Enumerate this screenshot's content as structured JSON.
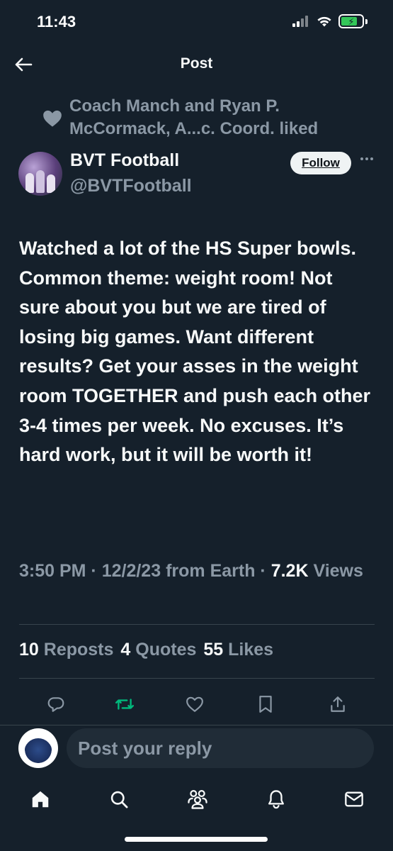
{
  "status_bar": {
    "time": "11:43"
  },
  "header": {
    "title": "Post"
  },
  "social_context": {
    "text": "Coach Manch and Ryan P. McCormack, A...c. Coord. liked"
  },
  "author": {
    "name": "BVT Football",
    "handle": "@BVTFootball",
    "follow_label": "Follow"
  },
  "post": {
    "text": "Watched a lot of the HS Super bowls. Common theme: weight room! Not sure about you but we are tired of losing big games. Want different results? Get your asses in the weight room TOGETHER and push each other 3-4 times per week. No excuses. It’s hard work, but it will be worth it!",
    "time": "3:50 PM",
    "date": "12/2/23",
    "source": "from Earth",
    "views_count": "7.2K",
    "views_label": "Views"
  },
  "stats": {
    "reposts_count": "10",
    "reposts_label": "Reposts",
    "quotes_count": "4",
    "quotes_label": "Quotes",
    "likes_count": "55",
    "likes_label": "Likes"
  },
  "actions": {
    "icons": [
      "reply-icon",
      "repost-icon",
      "like-icon",
      "bookmark-icon",
      "share-icon"
    ],
    "repost_color": "#00ba7c"
  },
  "reply": {
    "placeholder": "Post your reply"
  },
  "tabbar": {
    "icons": [
      "home-icon",
      "search-icon",
      "communities-icon",
      "notifications-icon",
      "messages-icon"
    ]
  },
  "colors": {
    "background": "#15202b",
    "text": "#f7f9f9",
    "secondary": "#8b98a5",
    "divider": "#38444d",
    "battery": "#34c759"
  }
}
